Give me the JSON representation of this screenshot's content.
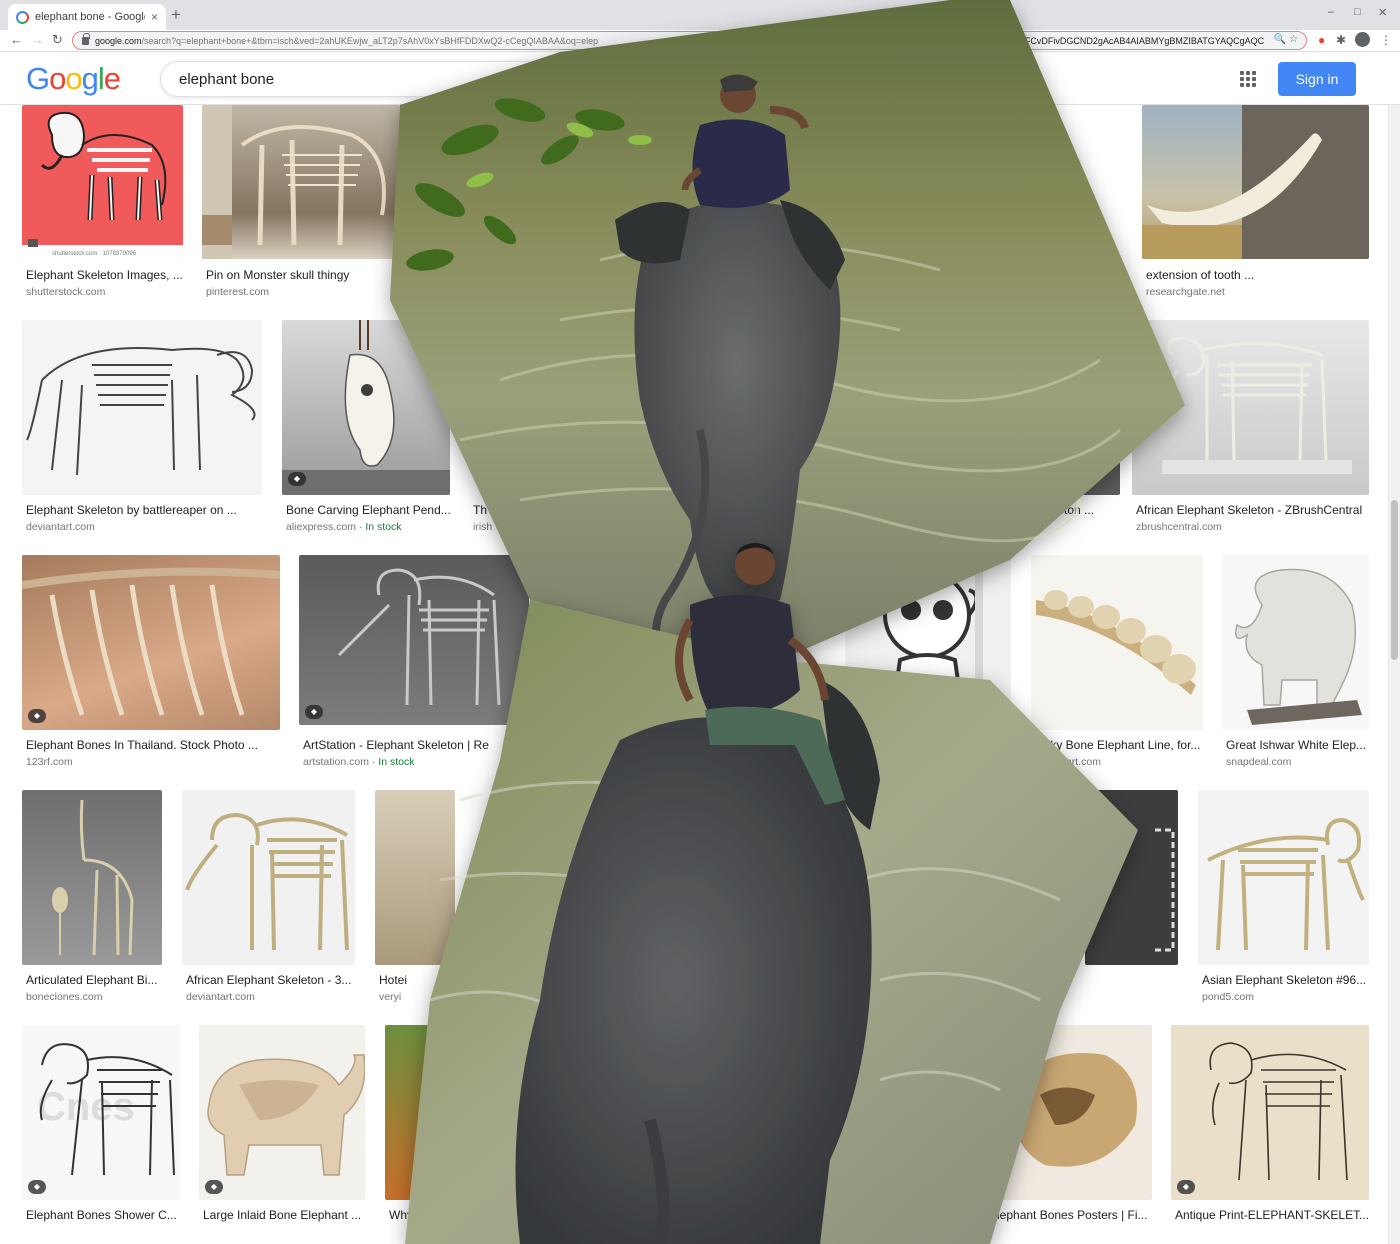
{
  "browser": {
    "tab_title": "elephant bone - Google S",
    "tab_close": "×",
    "new_tab": "+",
    "url_host": "google.com",
    "url_path": "/search?q=elephant+bone+&tbm=isch&ved=2ahUKEwjw_aLT2p7sAhV0xYsBHfFDDXwQ2-cCegQIABAA&oq=elep",
    "url_tail": "AyAggAMgIIAFCvDFivDGCND2gAcAB4AIABMYgBMZIBATGYAQCgAQC",
    "back": "←",
    "forward": "→",
    "reload": "↻",
    "minimize": "–",
    "maximize": "□",
    "close": "✕"
  },
  "header": {
    "logo": [
      "G",
      "o",
      "o",
      "g",
      "l",
      "e"
    ],
    "query": "elephant bone",
    "signin_label": "Sign in"
  },
  "results": [
    {
      "title": "Elephant Skeleton Images, ...",
      "source": "shutterstock.com",
      "stock": ""
    },
    {
      "title": "Pin on Monster skull thingy",
      "source": "pinterest.com",
      "stock": ""
    },
    {
      "title": "extension of tooth ...",
      "source": "researchgate.net",
      "stock": ""
    },
    {
      "title": "Elephant Skeleton by battlereaper on ...",
      "source": "deviantart.com",
      "stock": ""
    },
    {
      "title": "Bone Carving Elephant Pend...",
      "source": "aliexpress.com · ",
      "stock": "In stock"
    },
    {
      "title": "Th",
      "source": "irish",
      "stock": ""
    },
    {
      "title": "Skeleton ...",
      "source": "",
      "stock": ""
    },
    {
      "title": "African Elephant Skeleton - ZBrushCentral",
      "source": "zbrushcentral.com",
      "stock": ""
    },
    {
      "title": "Elephant Bones In Thailand. Stock Photo ...",
      "source": "123rf.com",
      "stock": ""
    },
    {
      "title": "ArtStation - Elephant Skeleton | Re",
      "source": "artstation.com · ",
      "stock": "In stock"
    },
    {
      "title": "Milky Bone Elephant Line, for...",
      "source": "indiamart.com",
      "stock": ""
    },
    {
      "title": "Great Ishwar White Elep...",
      "source": "snapdeal.com",
      "stock": ""
    },
    {
      "title": "Articulated Elephant Bi...",
      "source": "boneclones.com",
      "stock": ""
    },
    {
      "title": "African Elephant Skeleton - 3...",
      "source": "deviantart.com",
      "stock": ""
    },
    {
      "title": "Hotei",
      "source": "veryi",
      "stock": ""
    },
    {
      "title": "Asian Elephant Skeleton #96...",
      "source": "pond5.com",
      "stock": ""
    },
    {
      "title": "Elephant Bones Shower C...",
      "source": "",
      "stock": ""
    },
    {
      "title": "Large Inlaid Bone Elephant ...",
      "source": "",
      "stock": ""
    },
    {
      "title": "Why is th",
      "source": "",
      "stock": ""
    },
    {
      "title": "Elephant Bones Posters | Fi...",
      "source": "",
      "stock": ""
    },
    {
      "title": "Antique Print-ELEPHANT-SKELET...",
      "source": "",
      "stock": ""
    }
  ],
  "thumb_texts": {
    "shutterstock_watermark": "shutterstock.com · 1078379096"
  },
  "colors": {
    "accent": "#4285f4",
    "stock_green": "#188038",
    "thumb_red": "#f15a5a"
  }
}
